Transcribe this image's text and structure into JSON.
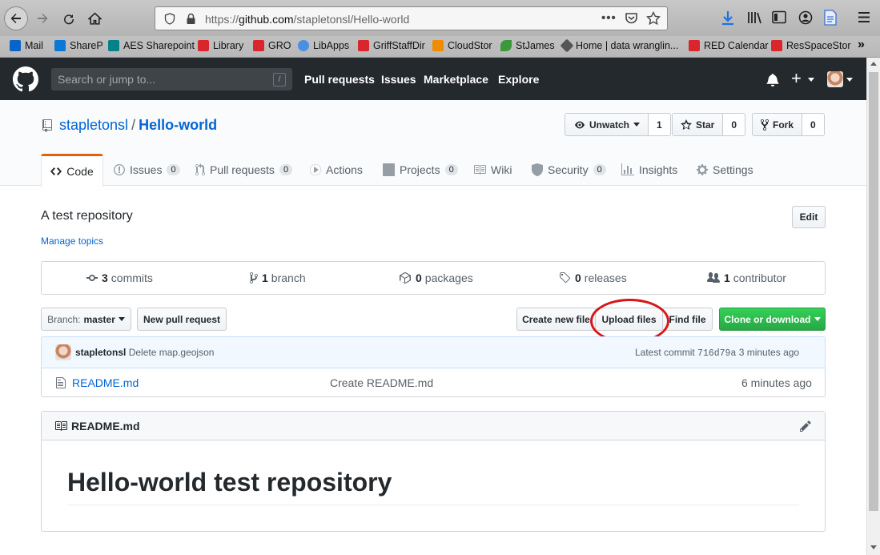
{
  "browser": {
    "url_prefix": "https://",
    "url_host": "github.com",
    "url_path": "/stapletonsl/Hello-world",
    "bookmarks": [
      {
        "label": "Mail",
        "color": "#0a64c8"
      },
      {
        "label": "ShareP",
        "color": "#0a78d4"
      },
      {
        "label": "AES Sharepoint",
        "color": "#038387"
      },
      {
        "label": "Library",
        "color": "#d9262d"
      },
      {
        "label": "GRO",
        "color": "#d9262d"
      },
      {
        "label": "LibApps",
        "color": "#4a90e2"
      },
      {
        "label": "GriffStaffDir",
        "color": "#d9262d"
      },
      {
        "label": "CloudStor",
        "color": "#f08c00"
      },
      {
        "label": "StJames",
        "color": "#3a9a3a"
      },
      {
        "label": "Home | data wranglin...",
        "color": "#555555"
      },
      {
        "label": "RED Calendar",
        "color": "#d9262d"
      },
      {
        "label": "ResSpaceStor",
        "color": "#d9262d"
      }
    ]
  },
  "header": {
    "search_placeholder": "Search or jump to...",
    "search_shortcut": "/",
    "nav": [
      "Pull requests",
      "Issues",
      "Marketplace",
      "Explore"
    ]
  },
  "repo": {
    "owner": "stapletonsl",
    "separator": "/",
    "name": "Hello-world",
    "watch": {
      "label": "Unwatch",
      "count": "1"
    },
    "star": {
      "label": "Star",
      "count": "0"
    },
    "fork": {
      "label": "Fork",
      "count": "0"
    }
  },
  "tabs": {
    "code": "Code",
    "issues": {
      "label": "Issues",
      "count": "0"
    },
    "pulls": {
      "label": "Pull requests",
      "count": "0"
    },
    "actions": "Actions",
    "projects": {
      "label": "Projects",
      "count": "0"
    },
    "wiki": "Wiki",
    "security": {
      "label": "Security",
      "count": "0"
    },
    "insights": "Insights",
    "settings": "Settings"
  },
  "main": {
    "description": "A test repository",
    "manage_topics": "Manage topics",
    "edit": "Edit",
    "summary": {
      "commits": {
        "count": "3",
        "label": "commits"
      },
      "branches": {
        "count": "1",
        "label": "branch"
      },
      "packages": {
        "count": "0",
        "label": "packages"
      },
      "releases": {
        "count": "0",
        "label": "releases"
      },
      "contributors": {
        "count": "1",
        "label": "contributor"
      }
    },
    "branch_label": "Branch:",
    "branch_name": "master",
    "new_pr": "New pull request",
    "create_file": "Create new file",
    "upload_files": "Upload files",
    "find_file": "Find file",
    "clone": "Clone or download",
    "commit": {
      "author": "stapletonsl",
      "message": "Delete map.geojson",
      "latest_label": "Latest commit",
      "sha": "716d79a",
      "time": "3 minutes ago"
    },
    "files": [
      {
        "name": "README.md",
        "message": "Create README.md",
        "age": "6 minutes ago"
      }
    ],
    "readme": {
      "filename": "README.md",
      "heading": "Hello-world test repository"
    }
  },
  "colors": {
    "header_bg": "#24292e",
    "link": "#0366d6",
    "clone_green": "#28a745",
    "highlight_red": "#d7161b",
    "tab_accent": "#e36209"
  }
}
